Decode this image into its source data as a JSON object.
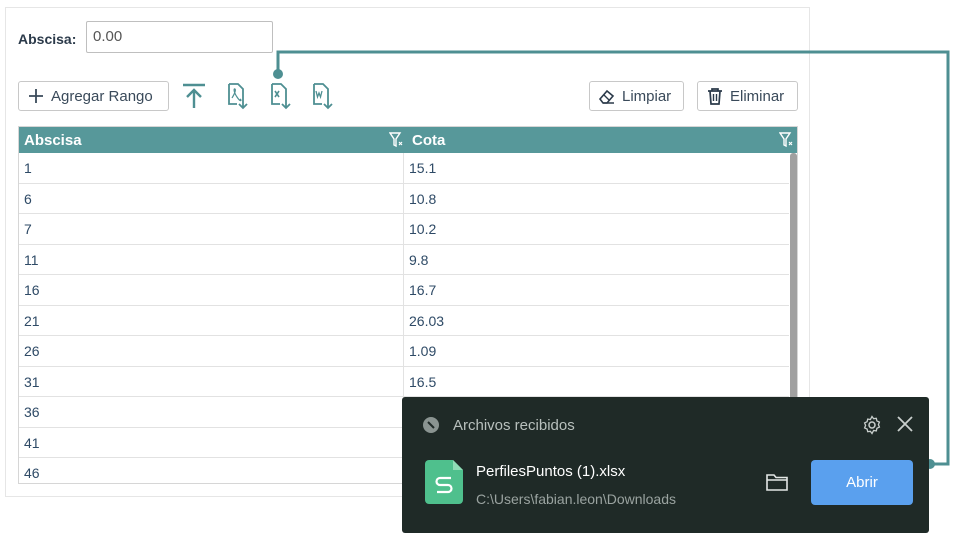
{
  "form": {
    "abscisa_label": "Abscisa:",
    "abscisa_value": "0.00"
  },
  "toolbar": {
    "add_range_label": "Agregar Rango",
    "upload_icon": "upload-icon",
    "pdf_icon": "pdf-export-icon",
    "excel_icon": "excel-export-icon",
    "word_icon": "word-export-icon",
    "clear_label": "Limpiar",
    "delete_label": "Eliminar"
  },
  "table": {
    "columns": [
      "Abscisa",
      "Cota"
    ],
    "rows": [
      [
        "1",
        "15.1"
      ],
      [
        "6",
        "10.8"
      ],
      [
        "7",
        "10.2"
      ],
      [
        "11",
        "9.8"
      ],
      [
        "16",
        "16.7"
      ],
      [
        "21",
        "26.03"
      ],
      [
        "26",
        "1.09"
      ],
      [
        "31",
        "16.5"
      ],
      [
        "36",
        ""
      ],
      [
        "41",
        ""
      ],
      [
        "46",
        ""
      ]
    ]
  },
  "downloads": {
    "title": "Archivos recibidos",
    "file_name": "PerfilesPuntos (1).xlsx",
    "file_path": "C:\\Users\\fabian.leon\\Downloads",
    "open_label": "Abrir"
  },
  "colors": {
    "accent": "#57989a",
    "popup_bg": "#1f2a27",
    "open_button": "#5aa0ee",
    "file_icon": "#4fc08d"
  }
}
